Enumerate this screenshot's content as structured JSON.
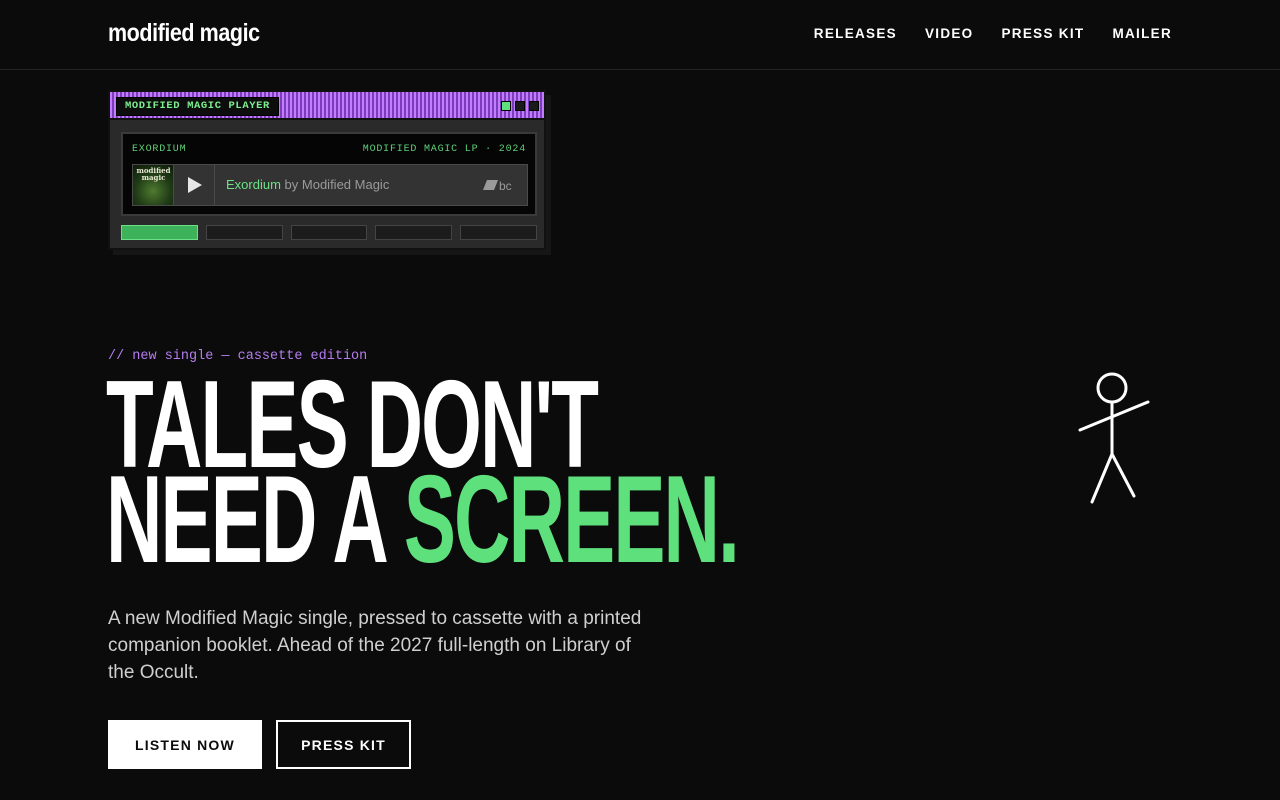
{
  "brand": {
    "logo": "modified magic"
  },
  "nav": {
    "items": [
      {
        "label": "RELEASES"
      },
      {
        "label": "VIDEO"
      },
      {
        "label": "PRESS KIT"
      },
      {
        "label": "MAILER"
      }
    ]
  },
  "player": {
    "title": "MODIFIED MAGIC PLAYER",
    "track_code": "EXORDIUM",
    "release_info": "MODIFIED MAGIC LP · 2024",
    "embed": {
      "track": "Exordium",
      "by": "by Modified Magic",
      "art_text": "modified magic",
      "source_logo": "bc"
    },
    "active_segment": 1,
    "segments": 5
  },
  "hero": {
    "kicker": "// new single — cassette edition",
    "headline_line1": "TALES DON'T",
    "headline_line2_start": "NEED A ",
    "headline_line2_accent": "SCREEN.",
    "lede": "A new Modified Magic single, pressed to cassette with a printed companion booklet. Ahead of the 2027 full-length on Library of the Occult.",
    "primary_cta": "LISTEN NOW",
    "secondary_cta": "PRESS KIT"
  },
  "colors": {
    "background": "#0b0b0b",
    "accent_green": "#5ee07d",
    "accent_purple": "#b47df0"
  }
}
